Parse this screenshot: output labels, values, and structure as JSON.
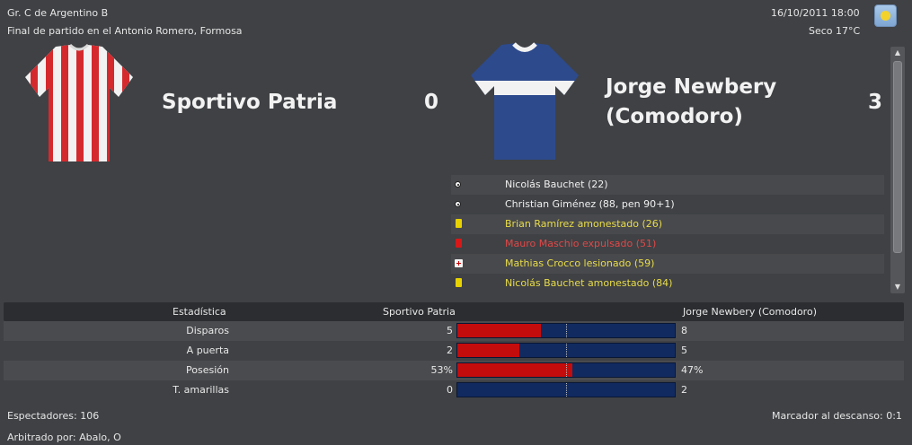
{
  "header": {
    "competition": "Gr. C de Argentino B",
    "venue_text": "Final de partido en el Antonio Romero, Formosa",
    "datetime": "16/10/2011 18:00",
    "weather": "Seco 17°C",
    "weather_icon": "sunny-icon"
  },
  "home": {
    "name": "Sportivo Patria",
    "score": "0",
    "kit_colors": [
      "#d42a2e",
      "#f2f2f2"
    ]
  },
  "away": {
    "name_line1": "Jorge Newbery",
    "name_line2": "(Comodoro)",
    "score": "3",
    "kit_colors": [
      "#2d4a8c",
      "#f2f2f2"
    ]
  },
  "events": [
    {
      "icon": "ball-icon",
      "text": "Nicolás Bauchet (22)",
      "color": "#f0f0f0"
    },
    {
      "icon": "ball-icon",
      "text": "Christian Giménez (88, pen 90+1)",
      "color": "#f0f0f0"
    },
    {
      "icon": "yellow-card-icon",
      "text": "Brian Ramírez amonestado (26)",
      "color": "#e8dc4a"
    },
    {
      "icon": "red-card-icon",
      "text": "Mauro Maschio expulsado (51)",
      "color": "#e04848"
    },
    {
      "icon": "injury-icon",
      "text": "Mathias Crocco lesionado (59)",
      "color": "#e8dc4a"
    },
    {
      "icon": "yellow-card-icon",
      "text": "Nicolás Bauchet amonestado (84)",
      "color": "#e8dc4a"
    }
  ],
  "stats": {
    "header_label": "Estadística",
    "home_team": "Sportivo Patria",
    "away_team": "Jorge Newbery (Comodoro)",
    "rows": [
      {
        "label": "Disparos",
        "home": "5",
        "away": "8",
        "home_share": 0.385
      },
      {
        "label": "A puerta",
        "home": "2",
        "away": "5",
        "home_share": 0.286
      },
      {
        "label": "Posesión",
        "home": "53%",
        "away": "47%",
        "home_share": 0.53
      },
      {
        "label": "T. amarillas",
        "home": "0",
        "away": "2",
        "home_share": 0.0
      }
    ]
  },
  "footer": {
    "attendance": "Espectadores: 106",
    "referee": "Arbitrado por: Abalo, O",
    "halftime": "Marcador al descanso: 0:1"
  },
  "colors": {
    "home_bar": "#c40c0c",
    "away_bar": "#112a60"
  }
}
